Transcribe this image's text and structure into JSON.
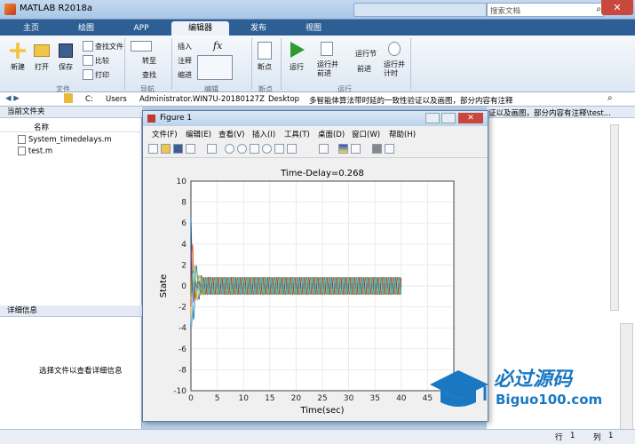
{
  "window": {
    "title": "MATLAB R2018a",
    "search_placeholder": "搜索文档"
  },
  "tabs": [
    "主页",
    "绘图",
    "APP",
    "编辑器",
    "发布",
    "视图"
  ],
  "ribbon": {
    "file": {
      "new": "新建",
      "open": "打开",
      "save": "保存",
      "find_files": "查找文件",
      "compare": "比较",
      "print": "打印",
      "group": "文件"
    },
    "nav": {
      "goto": "转至",
      "find": "查找",
      "group": "导航"
    },
    "edit": {
      "insert": "插入",
      "comment": "注释",
      "indent": "缩进",
      "fx": "fx",
      "group": "编辑"
    },
    "breakpoints": {
      "label": "断点",
      "group": "断点"
    },
    "run": {
      "run": "运行",
      "run_advance": "运行并\n前进",
      "run_section": "运行节",
      "advance": "前进",
      "run_time": "运行并\n计时",
      "group": "运行"
    }
  },
  "path": {
    "segments": [
      "C:",
      "Users",
      "Administrator.WIN7U-20180127Z",
      "Desktop",
      "多智能体算法带时延的一致性验证以及画图，部分内容有注释"
    ],
    "right_text": "证以及画图，部分内容有注释\\test..."
  },
  "current_folder": {
    "title": "当前文件夹",
    "column_name": "名称",
    "files": [
      "System_timedelays.m",
      "test.m"
    ]
  },
  "details": {
    "title": "详细信息",
    "hint": "选择文件以查看详细信息"
  },
  "status": {
    "row_label": "行",
    "row": "1",
    "col_label": "列",
    "col": "1"
  },
  "figure": {
    "title": "Figure 1",
    "menu": [
      "文件(F)",
      "编辑(E)",
      "查看(V)",
      "插入(I)",
      "工具(T)",
      "桌面(D)",
      "窗口(W)",
      "帮助(H)"
    ]
  },
  "chart_data": {
    "type": "line",
    "title": "Time-Delay=0.268",
    "xlabel": "Time(sec)",
    "ylabel": "State",
    "xlim": [
      0,
      50
    ],
    "ylim": [
      -10,
      10
    ],
    "xticks": [
      0,
      5,
      10,
      15,
      20,
      25,
      30,
      35,
      40,
      45,
      50
    ],
    "yticks": [
      10,
      8,
      6,
      4,
      2,
      0,
      -2,
      -4,
      -6,
      -8,
      -10
    ],
    "grid": true,
    "series_description": "multiple oscillating states, t from 0 to 40, amplitude ~0.8 around 0 after initial transient up to ±7",
    "series": [
      {
        "color": "#0072bd",
        "initial": 6.5,
        "phase": 0.0
      },
      {
        "color": "#d95319",
        "initial": -6.8,
        "phase": 1.0
      },
      {
        "color": "#edb120",
        "initial": 4.5,
        "phase": 2.1
      },
      {
        "color": "#7e2f8e",
        "initial": -3.5,
        "phase": 3.2
      },
      {
        "color": "#77ac30",
        "initial": 2.0,
        "phase": 4.2
      },
      {
        "color": "#4dbeee",
        "initial": -5.0,
        "phase": 5.2
      }
    ],
    "t_end": 40,
    "steady_amplitude": 0.8
  },
  "watermark": {
    "brand": "必过源码",
    "url": "Biguo100.com"
  }
}
